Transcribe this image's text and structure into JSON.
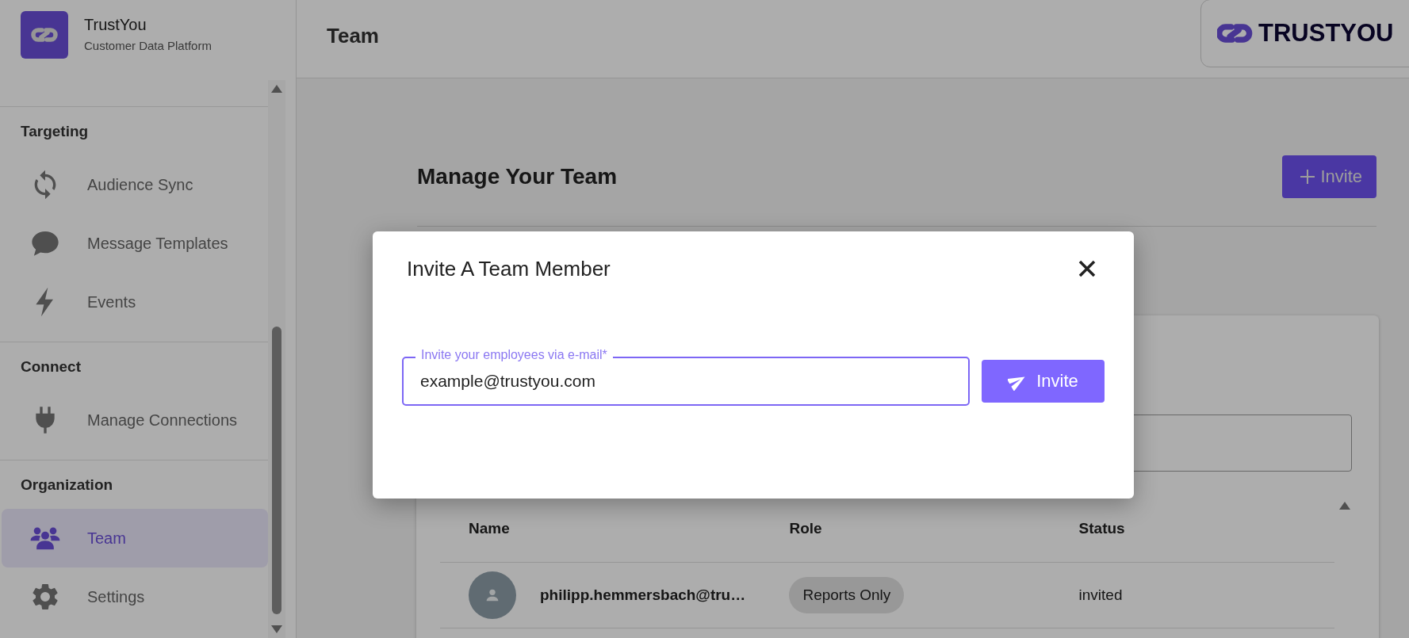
{
  "sidebar": {
    "brand": {
      "name": "TrustYou",
      "subtitle": "Customer Data Platform"
    },
    "sections": [
      {
        "title": "Targeting",
        "items": [
          {
            "label": "Audience Sync",
            "selected": false
          },
          {
            "label": "Message Templates",
            "selected": false
          },
          {
            "label": "Events",
            "selected": false
          }
        ]
      },
      {
        "title": "Connect",
        "items": [
          {
            "label": "Manage Connections",
            "selected": false
          }
        ]
      },
      {
        "title": "Organization",
        "items": [
          {
            "label": "Team",
            "selected": true
          },
          {
            "label": "Settings",
            "selected": false
          }
        ]
      }
    ]
  },
  "header": {
    "title": "Team",
    "logo_text": "TRUSTYOU"
  },
  "page": {
    "heading": "Manage Your Team",
    "invite_button": "Invite",
    "table": {
      "columns": [
        "Name",
        "Role",
        "Status"
      ],
      "rows": [
        {
          "name": "philipp.hemmersbach@tru…",
          "role": "Reports Only",
          "status": "invited"
        }
      ]
    }
  },
  "dialog": {
    "title": "Invite A Team Member",
    "field": {
      "label": "Invite your employees via e-mail*",
      "value": "example@trustyou.com"
    },
    "button": "Invite"
  }
}
